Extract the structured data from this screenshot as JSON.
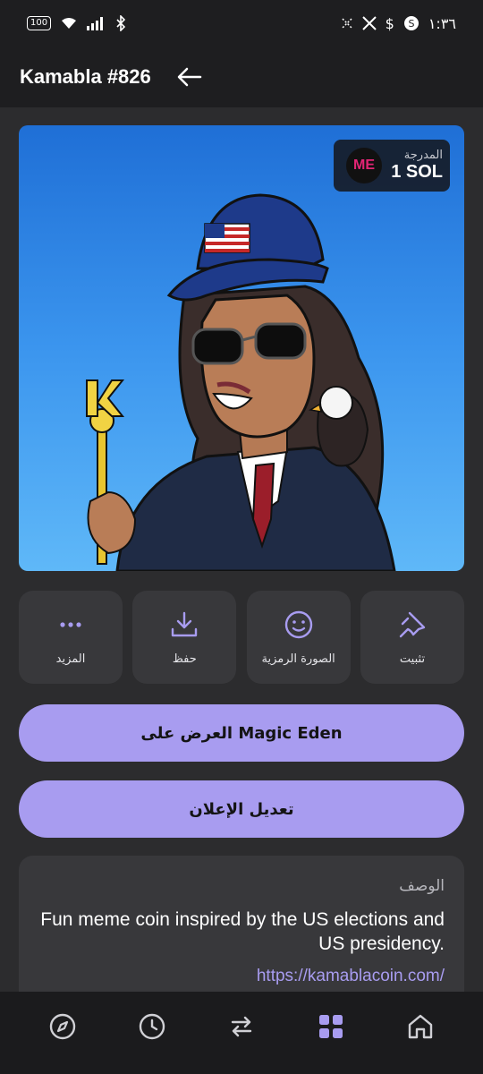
{
  "status": {
    "battery": "100",
    "time": "١:٣٦",
    "notification_icons": [
      "x-icon",
      "twitter-x-icon",
      "dollar-icon",
      "s-icon"
    ]
  },
  "header": {
    "title": "Kamabla #826"
  },
  "nft": {
    "price_label": "المدرجة",
    "price_value": "1 SOL",
    "marketplace_logo": "ME"
  },
  "actions": [
    {
      "label": "تثبيت",
      "icon": "pin-icon"
    },
    {
      "label": "الصورة الرمزية",
      "icon": "smiley-icon"
    },
    {
      "label": "حفظ",
      "icon": "download-icon"
    },
    {
      "label": "المزيد",
      "icon": "more-icon"
    }
  ],
  "buttons": {
    "view_on": "العرض على Magic Eden",
    "edit_listing": "تعديل الإعلان"
  },
  "description": {
    "title": "الوصف",
    "text": "Fun meme coin inspired by the US elections and US presidency.",
    "link": "https://kamablacoin.com/"
  },
  "nav": [
    "compass-icon",
    "clock-icon",
    "swap-icon",
    "collectibles-icon",
    "home-icon"
  ],
  "colors": {
    "accent": "#a89cf0",
    "background": "#2c2c2e",
    "card": "#38383b"
  }
}
